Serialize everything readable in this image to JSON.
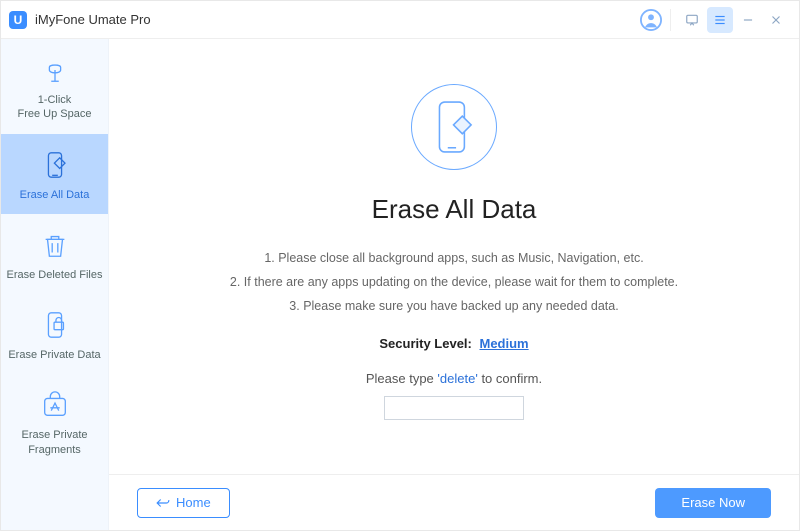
{
  "app": {
    "title": "iMyFone Umate Pro",
    "logo_letter": "U"
  },
  "sidebar": {
    "items": [
      {
        "label": "1-Click\nFree Up Space"
      },
      {
        "label": "Erase All Data"
      },
      {
        "label": "Erase Deleted Files"
      },
      {
        "label": "Erase Private Data"
      },
      {
        "label": "Erase Private\nFragments"
      }
    ]
  },
  "main": {
    "title": "Erase All Data",
    "instructions": [
      "1. Please close all background apps, such as Music, Navigation, etc.",
      "2. If there are any apps updating on the device, please wait for them to complete.",
      "3. Please make sure you have backed up any needed data."
    ],
    "security_label": "Security Level:",
    "security_value": "Medium",
    "confirm_prefix": "Please type",
    "confirm_keyword": "'delete'",
    "confirm_suffix": "to confirm."
  },
  "footer": {
    "home_label": "Home",
    "erase_label": "Erase Now"
  }
}
